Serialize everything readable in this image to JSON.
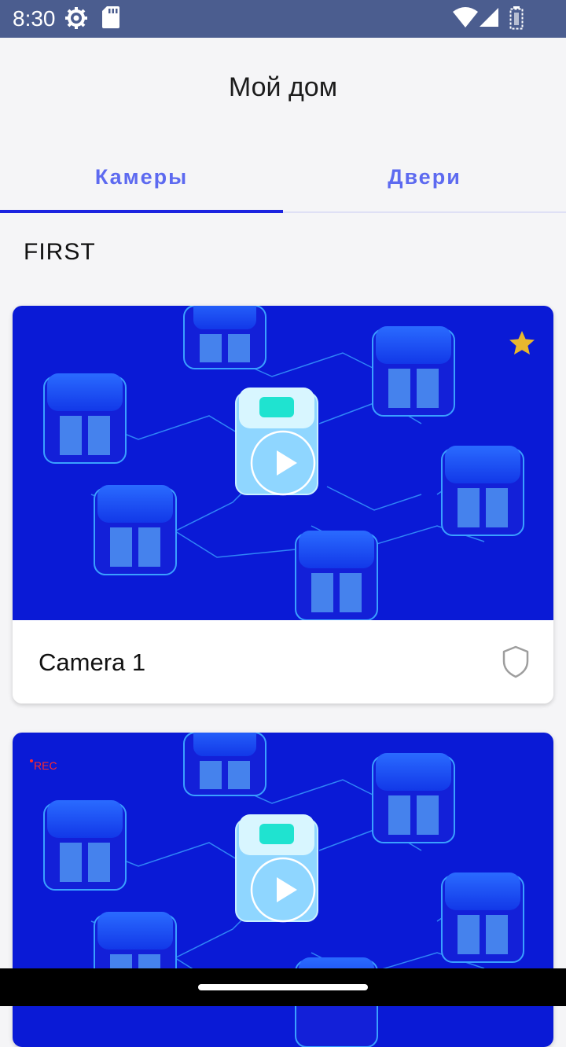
{
  "status_bar": {
    "time": "8:30",
    "icons": [
      "settings-icon",
      "sd-card-icon",
      "wifi-icon",
      "cell-signal-icon",
      "battery-icon"
    ]
  },
  "header": {
    "title": "Мой дом"
  },
  "tabs": [
    {
      "label": "Камеры",
      "selected": true
    },
    {
      "label": "Двери",
      "selected": false
    }
  ],
  "section": {
    "title": "FIRST"
  },
  "cameras": [
    {
      "name": "Camera 1",
      "favorite": true,
      "recording": false
    },
    {
      "name": "",
      "favorite": false,
      "recording": true,
      "rec_label": "REC"
    }
  ],
  "colors": {
    "accent": "#5d6af0",
    "indicator": "#1c24e0",
    "status_bar": "#4b5d8f",
    "preview_bg": "#0a1ad6",
    "favorite": "#e8b72e",
    "rec": "#ff2a2a"
  }
}
